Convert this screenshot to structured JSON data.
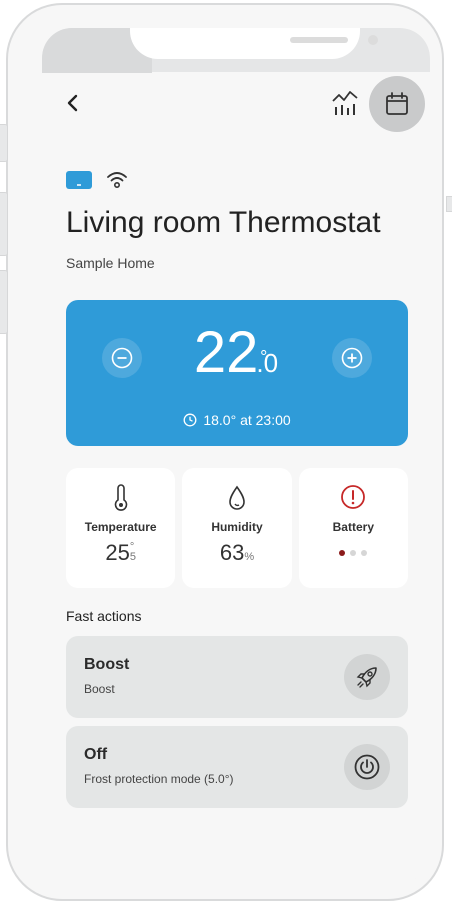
{
  "header": {
    "back_icon": "back-chevron-icon",
    "chart_icon": "chart-icon",
    "calendar_icon": "calendar-icon"
  },
  "device": {
    "title": "Living room Thermostat",
    "home": "Sample Home",
    "type_icon": "thermostat-device-icon",
    "connection_icon": "wifi-icon"
  },
  "setpoint": {
    "whole": "22",
    "decimal": ".0",
    "degree": "°",
    "schedule_text": "18.0° at 23:00",
    "schedule_icon": "clock-icon",
    "decrease_icon": "minus-icon",
    "increase_icon": "plus-icon"
  },
  "tiles": {
    "temperature": {
      "label": "Temperature",
      "whole": "25",
      "decimal": "5",
      "degree": "°",
      "icon": "thermometer-icon"
    },
    "humidity": {
      "label": "Humidity",
      "value": "63",
      "unit": "%",
      "icon": "droplet-icon"
    },
    "battery": {
      "label": "Battery",
      "icon": "alert-icon",
      "level_dots": 3,
      "level_filled": 1
    }
  },
  "fast_actions": {
    "title": "Fast actions",
    "items": [
      {
        "name": "Boost",
        "desc": "Boost",
        "icon": "rocket-icon"
      },
      {
        "name": "Off",
        "desc": "Frost protection mode (5.0°)",
        "icon": "power-icon"
      }
    ]
  },
  "colors": {
    "accent": "#2f9bd8",
    "alert": "#c62828",
    "battery_dot": "#8b1b1b"
  }
}
